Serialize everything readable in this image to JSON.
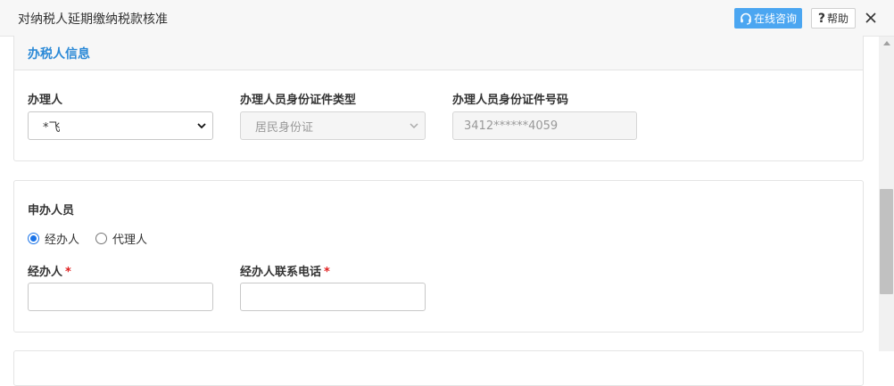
{
  "header": {
    "title": "对纳税人延期缴纳税款核准",
    "consult_label": "在线咨询",
    "help_label": "帮助",
    "help_mark": "?"
  },
  "taxpayer_info": {
    "section_title": "办税人信息",
    "handler_label": "办理人",
    "handler_value": "*飞",
    "id_type_label": "办理人员身份证件类型",
    "id_type_value": "居民身份证",
    "id_number_label": "办理人员身份证件号码",
    "id_number_value": "3412******4059"
  },
  "applicant": {
    "section_label": "申办人员",
    "options": [
      "经办人",
      "代理人"
    ],
    "selected_option": "经办人",
    "agent_label": "经办人",
    "agent_phone_label": "经办人联系电话",
    "required_mark": "*",
    "agent_value": "",
    "agent_phone_value": ""
  },
  "icons": {
    "consult": "headset-icon",
    "close": "close-icon",
    "dropdown": "chevron-down-icon"
  },
  "colors": {
    "accent": "#4ba6f1",
    "section_title": "#2c8ad7",
    "required": "#e02020"
  }
}
